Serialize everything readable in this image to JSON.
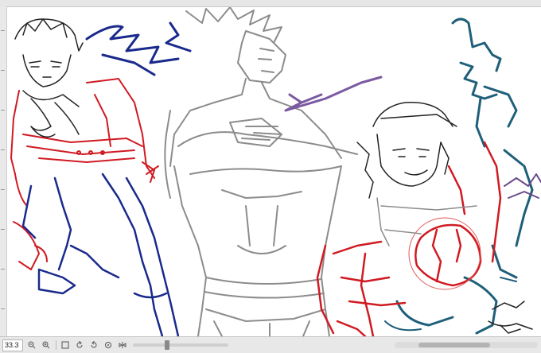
{
  "status_bar": {
    "zoom_value": "33.3",
    "icons": [
      "zoom-out-icon",
      "zoom-in-icon",
      "fit-icon",
      "rotate-left-icon",
      "rotate-right-icon",
      "reset-icon",
      "flip-icon"
    ]
  },
  "colors": {
    "ui_gray": "#e8e8e8",
    "sketch_gray": "#8c8c8c",
    "sketch_red": "#d01a22",
    "sketch_navy": "#1a2a8c",
    "sketch_teal": "#1f5f7a",
    "sketch_purple": "#7a5aa0",
    "sketch_black": "#222222"
  }
}
